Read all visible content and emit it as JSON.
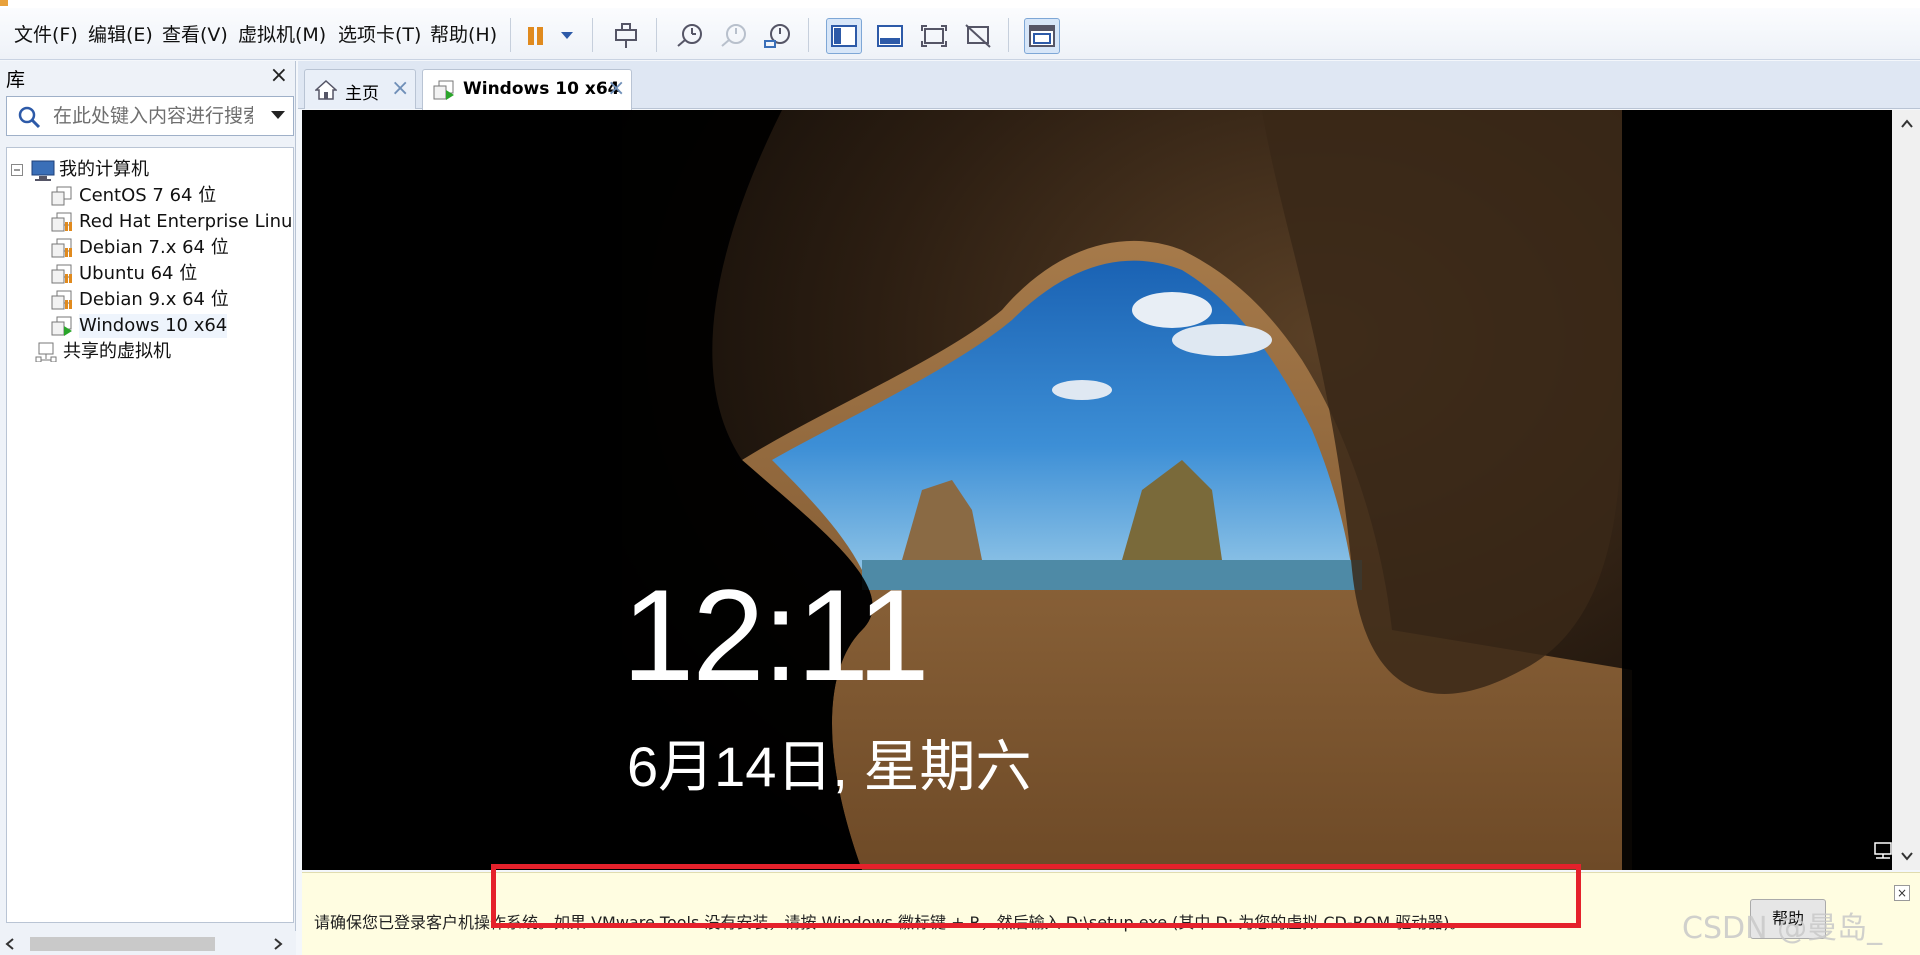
{
  "menu": {
    "file": "文件(F)",
    "edit": "编辑(E)",
    "view": "查看(V)",
    "vm": "虚拟机(M)",
    "tabs": "选项卡(T)",
    "help": "帮助(H)"
  },
  "toolbar": {
    "icons": [
      "pause-icon",
      "dropdown-icon",
      "send-ctrl-alt-del-icon",
      "snapshot-icon",
      "revert-snapshot-icon",
      "snapshot-manager-icon",
      "show-library-icon",
      "thumbnail-bar-icon",
      "full-screen-icon",
      "unity-icon",
      "console-view-icon"
    ],
    "accent": "#e08a1e"
  },
  "library": {
    "title": "库",
    "search_placeholder": "在此处键入内容进行搜索",
    "tree": {
      "root": "我的计算机",
      "items": [
        "CentOS 7 64 位",
        "Red Hat Enterprise Linu",
        "Debian 7.x 64 位",
        "Ubuntu 64 位",
        "Debian 9.x 64 位",
        "Windows 10 x64"
      ],
      "shared": "共享的虚拟机"
    }
  },
  "tabs": [
    {
      "label": "主页"
    },
    {
      "label": "Windows 10 x64"
    }
  ],
  "vm_screen": {
    "time": "12:11",
    "date": "6月14日, 星期六"
  },
  "notification": {
    "text": "请确保您已登录客户机操作系统。如果 VMware Tools 没有安装，请按 Windows 徽标键 + R，然后输入 D:\\setup.exe (其中 D: 为您的虚拟 CD-ROM 驱动器)。",
    "button": "帮助",
    "highlight_color": "#e5212b"
  },
  "watermark": "CSDN @曼岛_"
}
